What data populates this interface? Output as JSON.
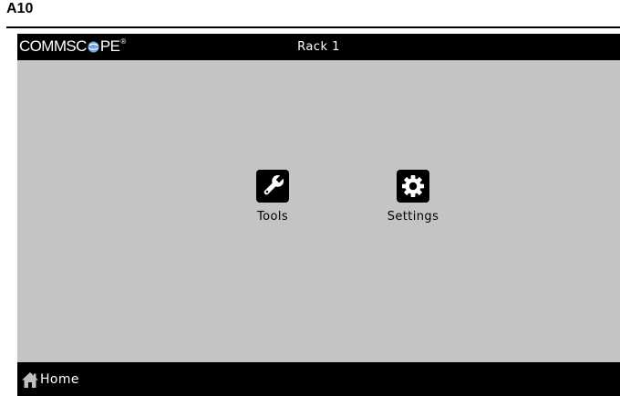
{
  "figure": {
    "label": "A10"
  },
  "header": {
    "brand_prefix": "COMMSC",
    "brand_suffix": "PE",
    "brand_mark": "®",
    "title": "Rack 1"
  },
  "main": {
    "apps": [
      {
        "label": "Tools",
        "icon": "wrench-icon"
      },
      {
        "label": "Settings",
        "icon": "gear-icon"
      }
    ]
  },
  "footer": {
    "home_label": "Home",
    "home_icon": "house-icon"
  },
  "colors": {
    "screen_background": "#c4c4c4",
    "bar_background": "#000000",
    "bar_text": "#ffffff",
    "logo_globe": "#6fa8dc"
  }
}
